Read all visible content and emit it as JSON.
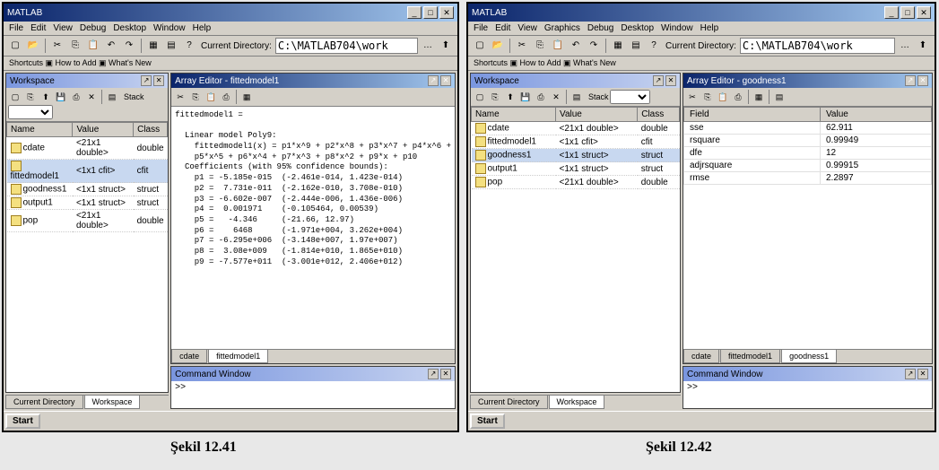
{
  "app_title": "MATLAB",
  "menus_left": [
    "File",
    "Edit",
    "View",
    "Debug",
    "Desktop",
    "Window",
    "Help"
  ],
  "menus_right": [
    "File",
    "Edit",
    "View",
    "Graphics",
    "Debug",
    "Desktop",
    "Window",
    "Help"
  ],
  "dir_label": "Current Directory:",
  "dir_path": "C:\\MATLAB704\\work",
  "shortcuts_text": "Shortcuts ▣ How to Add ▣ What's New",
  "start_label": "Start",
  "caption1": "Şekil 12.41",
  "caption2": "Şekil 12.42",
  "workspace": {
    "title1": "Workspace",
    "title2": "Workspace",
    "headers": [
      "Name",
      "Value",
      "Class"
    ],
    "stack_label": "Stack",
    "rows": [
      {
        "name": "cdate",
        "value": "<21x1 double>",
        "class": "double"
      },
      {
        "name": "fittedmodel1",
        "value": "<1x1 cfit>",
        "class": "cfit"
      },
      {
        "name": "goodness1",
        "value": "<1x1 struct>",
        "class": "struct"
      },
      {
        "name": "output1",
        "value": "<1x1 struct>",
        "class": "struct"
      },
      {
        "name": "pop",
        "value": "<21x1 double>",
        "class": "double"
      }
    ]
  },
  "array_editor1": {
    "title": "Array Editor - fittedmodel1",
    "content": "fittedmodel1 =\n\n  Linear model Poly9:\n    fittedmodel1(x) = p1*x^9 + p2*x^8 + p3*x^7 + p4*x^6 +\n    p5*x^5 + p6*x^4 + p7*x^3 + p8*x^2 + p9*x + p10\n  Coefficients (with 95% confidence bounds):\n    p1 = -5.185e-015  (-2.461e-014, 1.423e-014)\n    p2 =  7.731e-011  (-2.162e-010, 3.708e-010)\n    p3 = -6.602e-007  (-2.444e-006, 1.436e-006)\n    p4 =  0.001971    (-0.105464, 0.00539)\n    p5 =   -4.346     (-21.66, 12.97)\n    p6 =    6468      (-1.971e+004, 3.262e+004)\n    p7 = -6.295e+006  (-3.148e+007, 1.97e+007)\n    p8 =  3.08e+009   (-1.814e+010, 1.865e+010)\n    p9 = -7.577e+011  (-3.001e+012, 2.406e+012)",
    "tabs": [
      "cdate",
      "fittedmodel1"
    ]
  },
  "array_editor2": {
    "title": "Array Editor - goodness1",
    "headers": [
      "Field",
      "Value"
    ],
    "rows": [
      {
        "field": "sse",
        "value": "62.911"
      },
      {
        "field": "rsquare",
        "value": "0.99949"
      },
      {
        "field": "dfe",
        "value": "12"
      },
      {
        "field": "adjrsquare",
        "value": "0.99915"
      },
      {
        "field": "rmse",
        "value": "2.2897"
      }
    ],
    "tabs": [
      "cdate",
      "fittedmodel1",
      "goodness1"
    ]
  },
  "cmd_window": {
    "title": "Command Window",
    "prompt": ">>"
  },
  "bottom_tabs_left": [
    "Current Directory",
    "Workspace"
  ],
  "bottom_tabs_right": [
    "Current Directory",
    "Workspace"
  ],
  "win_btns": {
    "min": "_",
    "max": "□",
    "close": "✕"
  }
}
